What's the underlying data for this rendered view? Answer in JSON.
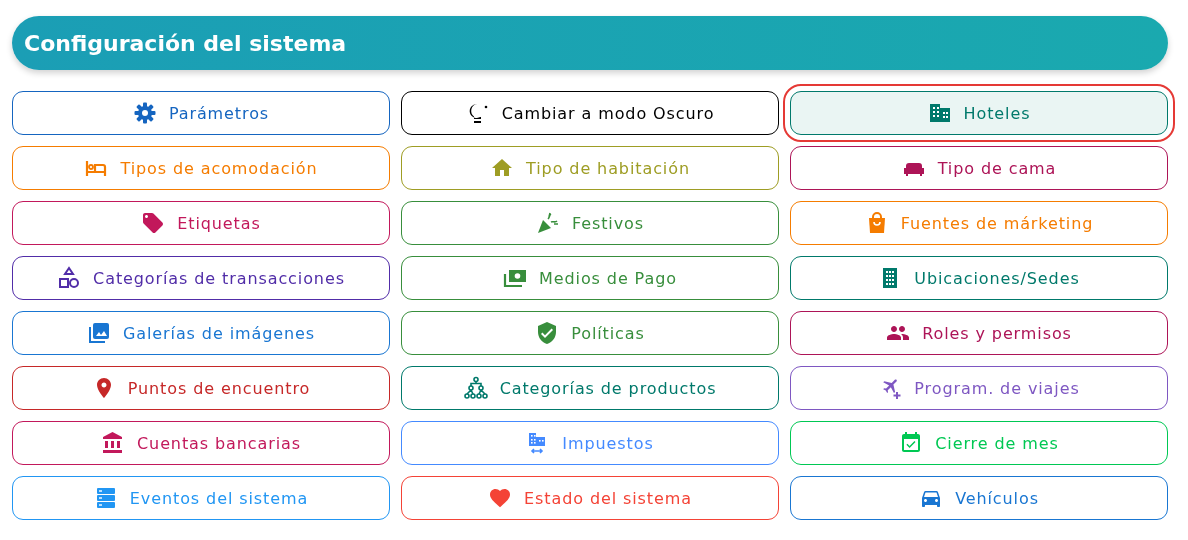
{
  "header": {
    "title": "Configuración del sistema"
  },
  "buttons": [
    {
      "label": "Parámetros",
      "color": "#1565c0",
      "selected": false
    },
    {
      "label": "Cambiar a modo Oscuro",
      "color": "#000000",
      "selected": false
    },
    {
      "label": "Hoteles",
      "color": "#00796b",
      "selected": true
    },
    {
      "label": "Tipos de acomodación",
      "color": "#f57c00",
      "selected": false
    },
    {
      "label": "Tipo de habitación",
      "color": "#9e9d24",
      "selected": false
    },
    {
      "label": "Tipo de cama",
      "color": "#ad1457",
      "selected": false
    },
    {
      "label": "Etiquetas",
      "color": "#c2185b",
      "selected": false
    },
    {
      "label": "Festivos",
      "color": "#388e3c",
      "selected": false
    },
    {
      "label": "Fuentes de márketing",
      "color": "#f57c00",
      "selected": false
    },
    {
      "label": "Categorías de transacciones",
      "color": "#512da8",
      "selected": false
    },
    {
      "label": "Medios de Pago",
      "color": "#388e3c",
      "selected": false
    },
    {
      "label": "Ubicaciones/Sedes",
      "color": "#00796b",
      "selected": false
    },
    {
      "label": "Galerías de imágenes",
      "color": "#1976d2",
      "selected": false
    },
    {
      "label": "Políticas",
      "color": "#388e3c",
      "selected": false
    },
    {
      "label": "Roles y permisos",
      "color": "#ad1457",
      "selected": false
    },
    {
      "label": "Puntos de encuentro",
      "color": "#c62828",
      "selected": false
    },
    {
      "label": "Categorías de productos",
      "color": "#00796b",
      "selected": false
    },
    {
      "label": "Program. de viajes",
      "color": "#7e57c2",
      "selected": false
    },
    {
      "label": "Cuentas bancarias",
      "color": "#c2185b",
      "selected": false
    },
    {
      "label": "Impuestos",
      "color": "#448aff",
      "selected": false
    },
    {
      "label": "Cierre de mes",
      "color": "#00c853",
      "selected": false
    },
    {
      "label": "Eventos del sistema",
      "color": "#2196f3",
      "selected": false
    },
    {
      "label": "Estado del sistema",
      "color": "#f44336",
      "selected": false
    },
    {
      "label": "Vehículos",
      "color": "#1976d2",
      "selected": false
    }
  ]
}
